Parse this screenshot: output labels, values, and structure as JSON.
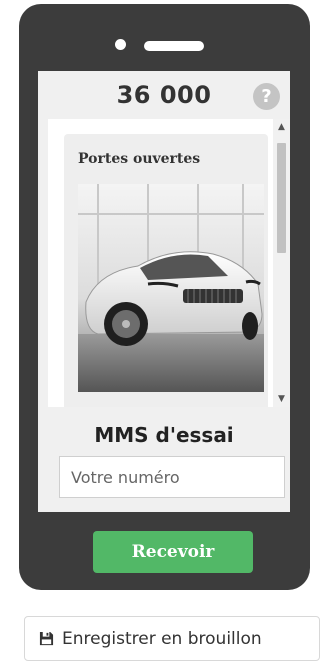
{
  "counter": {
    "value": "36 000",
    "help_icon": "?"
  },
  "preview": {
    "subject": "Portes ouvertes",
    "image_icon": "car-photo"
  },
  "scrollbar": {
    "up_icon": "▲",
    "down_icon": "▼"
  },
  "mms": {
    "title": "MMS d'essai",
    "phone_placeholder": "Votre numéro",
    "phone_value": "",
    "receive_label": "Recevoir"
  },
  "actions": {
    "draft_label": "Enregistrer en brouillon",
    "draft_icon": "floppy-disk-icon"
  },
  "colors": {
    "phone_frame": "#3c3c3c",
    "receive_button": "#52b867"
  }
}
